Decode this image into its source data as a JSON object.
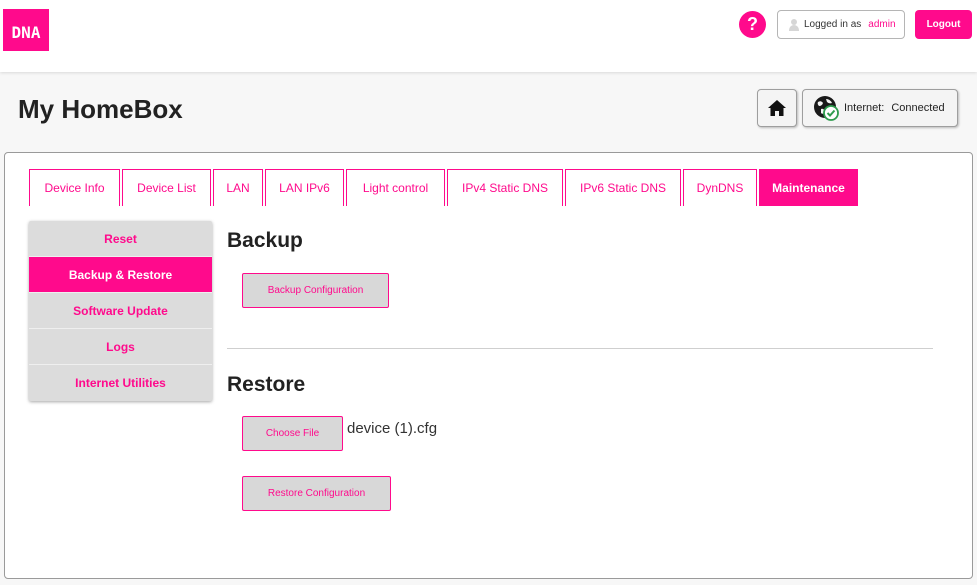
{
  "header": {
    "logo_text": "DNA",
    "help_symbol": "?",
    "logged_in_label": "Logged in as",
    "username": "admin",
    "logout_label": "Logout"
  },
  "page": {
    "title": "My HomeBox",
    "internet_label": "Internet:",
    "internet_status": "Connected"
  },
  "tabs": [
    {
      "label": "Device Info"
    },
    {
      "label": "Device List"
    },
    {
      "label": "LAN"
    },
    {
      "label": "LAN IPv6"
    },
    {
      "label": "Light control"
    },
    {
      "label": "IPv4 Static DNS"
    },
    {
      "label": "IPv6 Static DNS"
    },
    {
      "label": "DynDNS"
    },
    {
      "label": "Maintenance",
      "active": true
    }
  ],
  "side_menu": [
    {
      "label": "Reset"
    },
    {
      "label": "Backup & Restore",
      "active": true
    },
    {
      "label": "Software Update"
    },
    {
      "label": "Logs"
    },
    {
      "label": "Internet Utilities"
    }
  ],
  "backup": {
    "heading": "Backup",
    "button_label": "Backup Configuration"
  },
  "restore": {
    "heading": "Restore",
    "choose_file_label": "Choose File",
    "file_name": "device (1).cfg",
    "button_label": "Restore Configuration"
  },
  "colors": {
    "accent": "#ff0a8c",
    "status_ok": "#2e9c4d"
  },
  "icons": {
    "home": "home-icon",
    "globe": "globe-connected-icon",
    "user": "user-icon",
    "help": "help-icon"
  }
}
